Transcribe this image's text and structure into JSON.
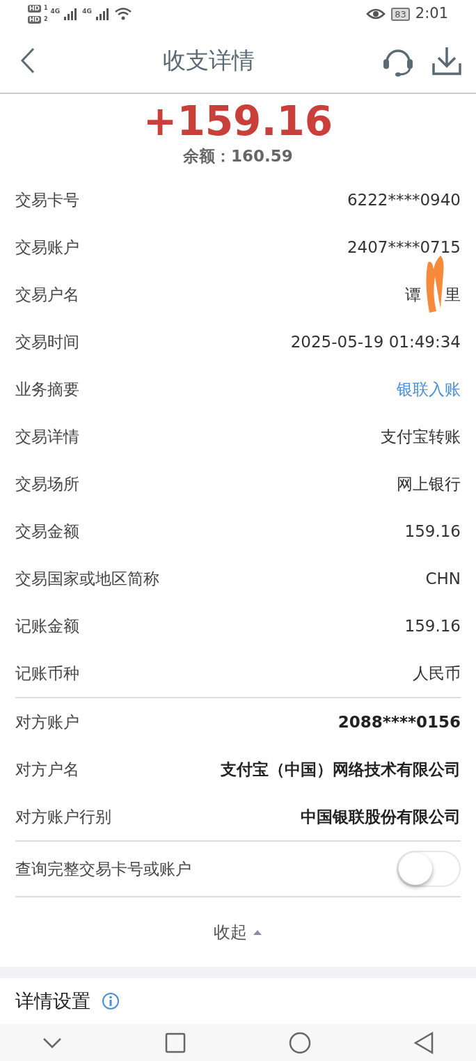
{
  "status_bar": {
    "sims": [
      {
        "label": "HD",
        "slot": "1"
      },
      {
        "label": "HD",
        "slot": "2"
      }
    ],
    "networks": [
      "4G",
      "4G"
    ],
    "battery": "83",
    "time": "2:01"
  },
  "header": {
    "title": "收支详情"
  },
  "amount": "+159.16",
  "balance_label": "余额：",
  "balance": "160.59",
  "groups": [
    [
      {
        "label": "交易卡号",
        "value": "6222****0940",
        "kind": "plain"
      },
      {
        "label": "交易账户",
        "value": "2407****0715",
        "kind": "plain"
      },
      {
        "label": "交易户名",
        "value_parts": [
          "谭",
          "里"
        ],
        "kind": "masked"
      },
      {
        "label": "交易时间",
        "value": "2025-05-19 01:49:34",
        "kind": "plain"
      },
      {
        "label": "业务摘要",
        "value": "银联入账",
        "kind": "link"
      },
      {
        "label": "交易详情",
        "value": "支付宝转账",
        "kind": "plain"
      },
      {
        "label": "交易场所",
        "value": "网上银行",
        "kind": "plain"
      },
      {
        "label": "交易金额",
        "value": "159.16",
        "kind": "plain"
      },
      {
        "label": "交易国家或地区简称",
        "value": "CHN",
        "kind": "plain"
      },
      {
        "label": "记账金额",
        "value": "159.16",
        "kind": "plain"
      },
      {
        "label": "记账币种",
        "value": "人民币",
        "kind": "plain"
      }
    ],
    [
      {
        "label": "对方账户",
        "value": "2088****0156",
        "kind": "strong"
      },
      {
        "label": "对方户名",
        "value": "支付宝（中国）网络技术有限公司",
        "kind": "strong"
      },
      {
        "label": "对方账户行别",
        "value": "中国银联股份有限公司",
        "kind": "strong"
      }
    ]
  ],
  "toggle": {
    "label": "查询完整交易卡号或账户",
    "on": false
  },
  "collapse": {
    "label": "收起"
  },
  "settings": {
    "title": "详情设置"
  }
}
